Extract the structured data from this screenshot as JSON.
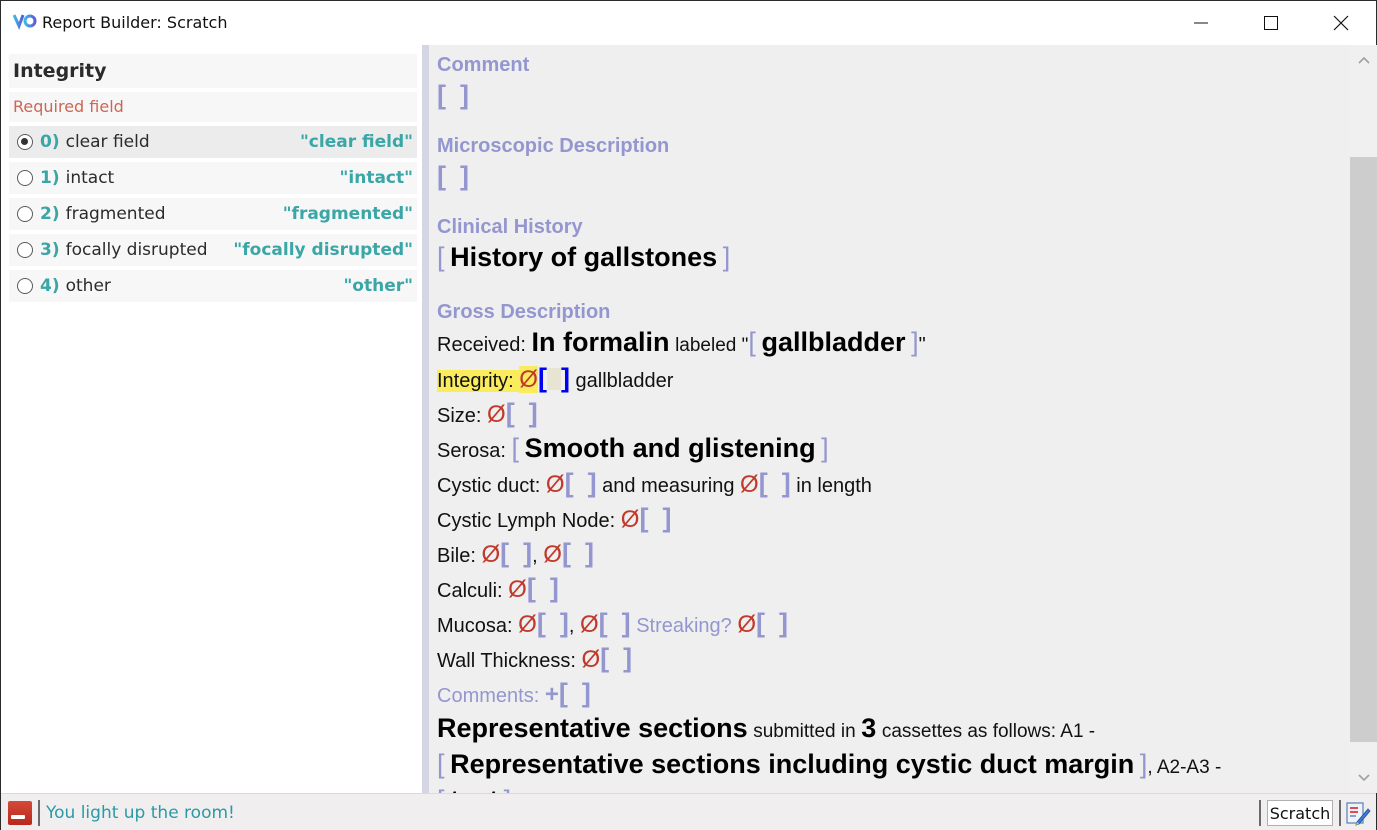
{
  "window": {
    "title": "Report Builder: Scratch",
    "controls": {
      "minimize": "minimize",
      "maximize": "maximize",
      "close": "close"
    }
  },
  "left_panel": {
    "field_title": "Integrity",
    "required_label": "Required field",
    "options": [
      {
        "num": "0)",
        "label": "clear field",
        "value": "\"clear field\"",
        "selected": true
      },
      {
        "num": "1)",
        "label": "intact",
        "value": "\"intact\"",
        "selected": false
      },
      {
        "num": "2)",
        "label": "fragmented",
        "value": "\"fragmented\"",
        "selected": false
      },
      {
        "num": "3)",
        "label": "focally disrupted",
        "value": "\"focally disrupted\"",
        "selected": false
      },
      {
        "num": "4)",
        "label": "other",
        "value": "\"other\"",
        "selected": false
      }
    ]
  },
  "editor": {
    "null_symbol": "Ø",
    "open_bracket": "[",
    "close_bracket": "]",
    "plus_symbol": "+",
    "sections": {
      "comment": {
        "heading": "Comment"
      },
      "microscopic": {
        "heading": "Microscopic Description"
      },
      "clinical": {
        "heading": "Clinical History",
        "value": "History of gallstones"
      },
      "gross": {
        "heading": "Gross Description",
        "received_label": "Received:",
        "received_value": "In formalin",
        "labeled_text": "labeled \"",
        "labeled_value": "gallbladder",
        "labeled_close": "\"",
        "integrity_label": "Integrity:",
        "integrity_suffix": "gallbladder",
        "size_label": "Size:",
        "serosa_label": "Serosa:",
        "serosa_value": "Smooth and glistening",
        "cystic_duct_label": "Cystic duct:",
        "cystic_duct_mid": "and measuring",
        "cystic_duct_end": "in length",
        "lymph_label": "Cystic Lymph Node:",
        "bile_label": "Bile:",
        "comma": ",",
        "calculi_label": "Calculi:",
        "mucosa_label": "Mucosa:",
        "streaking_label": "Streaking?",
        "wall_label": "Wall Thickness:",
        "comments_label": "Comments:",
        "rep_sections": "Representative sections",
        "submitted_in": "submitted in",
        "cassette_count": "3",
        "cassettes_follow": "cassettes as follows:  A1 -",
        "a1_value": "Representative sections including cystic duct margin",
        "a2_label": ", A2-A3 -",
        "a2_value": "test"
      }
    }
  },
  "status_bar": {
    "message": "You light up the room!",
    "mode": "Scratch"
  },
  "colors": {
    "accent_teal": "#3aa6a6",
    "bracket_lavender": "#9496cf",
    "null_red": "#c0392b",
    "highlight_yellow": "#fbec5d",
    "active_bracket_blue": "#0000ee",
    "required_red": "#cc6655"
  }
}
